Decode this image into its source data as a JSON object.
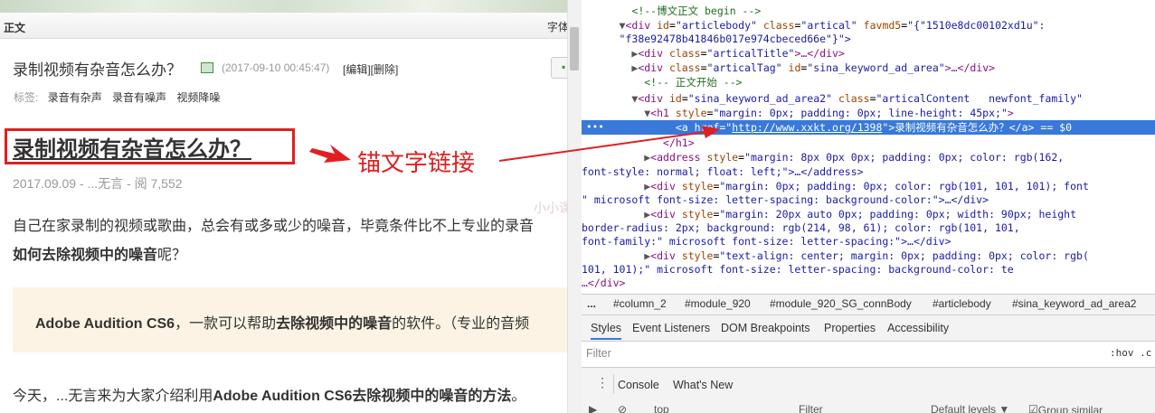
{
  "left_page": {
    "header": {
      "label": "正文",
      "right_label": "字体"
    },
    "article": {
      "title": "录制视频有杂音怎么办？",
      "date": "(2017-09-10 00:45:47)",
      "edit_links": "[编辑][删除]",
      "tags_label": "标签:",
      "tags": [
        "录音有杂声",
        "录音有噪声",
        "视频降噪"
      ]
    },
    "h1_link": "录制视频有杂音怎么办？",
    "meta": "2017.09.09 - ...无言 - 阅 7,552",
    "para1_line1": "自己在家录制的视频或歌曲，总会有或多或少的噪音，毕竟条件比不上专业的录音",
    "para1_line2_bold": "如何去除视频中的噪音",
    "para1_line2_rest": "呢？",
    "quote_bold1": "Adobe Audition CS6",
    "quote_mid1": "，一款可以帮助",
    "quote_bold2": "去除视频中的噪音",
    "quote_mid2": "的软件。（专业的音频",
    "para2_start": "今天，...无言来为大家介绍利用",
    "para2_bold": "Adobe Audition CS6去除视频中的噪音的方法",
    "para2_end": "。",
    "watermark": "小小课堂"
  },
  "annotation": {
    "text": "锚文字链接",
    "color": "#e02020"
  },
  "devtools": {
    "lines": {
      "l1": {
        "tri": "  ",
        "cm": "<!--博文正文 begin -->"
      },
      "l2_tag": "<div",
      "l2_a1": "id",
      "l2_v1": "\"articlebody\"",
      "l2_a2": "class",
      "l2_v2": "\"artical\"",
      "l2_a3": "favmd5",
      "l2_v3": "\"{\"1510e8dc00102xd1u\":",
      "l3_v": "\"f38e92478b41846b017e974cbeced66e\"}\">",
      "l4_tag": "<div",
      "l4_a": "class",
      "l4_v": "\"articalTitle\"",
      "l4_rest": ">…</div>",
      "l5_tag": "<div",
      "l5_a1": "class",
      "l5_v1": "\"articalTag\"",
      "l5_a2": "id",
      "l5_v2": "\"sina_keyword_ad_area\"",
      "l5_rest": ">…</div>",
      "l6_cm": "<!-- 正文开始 -->",
      "l7_tag": "<div",
      "l7_a1": "id",
      "l7_v1": "\"sina_keyword_ad_area2\"",
      "l7_a2": "class",
      "l7_v2": "\"articalContent   newfont_family\"",
      "l8_tag": "<h1",
      "l8_a": "style",
      "l8_v": "\"margin: 0px; padding: 0px; line-height: 45px;\"",
      "sel_tag": "<a",
      "sel_a": "href",
      "sel_url": "http://www.xxkt.org/1398",
      "sel_text": "录制视频有杂音怎么办？",
      "sel_close": "</a>",
      "sel_eq": "== $0",
      "l10": "</h1>",
      "l11_tag": "<address",
      "l11_a": "style",
      "l11_v": "\"margin: 8px 0px 0px; padding: 0px; color: rgb(162,",
      "l12_v": "font-style: normal; float: left;\">…</address>",
      "l13_tag": "<div",
      "l13_a": "style",
      "l13_v": "\"margin: 0px; padding: 0px; color: rgb(101, 101, 101); font",
      "l14_v": "\" microsoft font-size: letter-spacing: background-color:\">…</div>",
      "l15_tag": "<div",
      "l15_a": "style",
      "l15_v": "\"margin: 20px auto 0px; padding: 0px; width: 90px; height",
      "l16_v": "border-radius: 2px; background: rgb(214, 98, 61); color: rgb(101, 101,",
      "l17_v": "font-family:\" microsoft font-size: letter-spacing:\">…</div>",
      "l18_tag": "<div",
      "l18_a": "style",
      "l18_v": "\"text-align: center; margin: 0px; padding: 0px; color: rgb(",
      "l19_v": "101, 101);\" microsoft font-size: letter-spacing: background-color: te",
      "l20": "…</div>"
    },
    "breadcrumbs": [
      "...",
      "#column_2",
      "#module_920",
      "#module_920_SG_connBody",
      "#articlebody",
      "#sina_keyword_ad_area2"
    ],
    "tabs": [
      "Styles",
      "Event Listeners",
      "DOM Breakpoints",
      "Properties",
      "Accessibility"
    ],
    "filter_placeholder": "Filter",
    "hov_label": ":hov .c",
    "drawer_tabs": [
      "Console",
      "What's New"
    ],
    "console_toolbar": {
      "context": "top",
      "filter": "Filter",
      "levels": "Default levels ▼",
      "group": "Group similar"
    }
  }
}
